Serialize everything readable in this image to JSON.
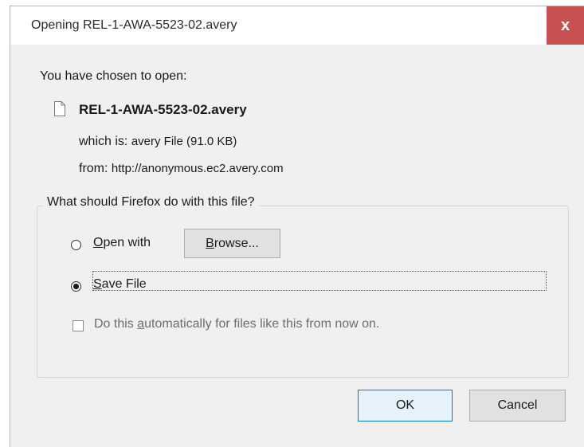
{
  "titlebar": {
    "title": "Opening REL-1-AWA-5523-02.avery",
    "close_label": "x"
  },
  "intro": {
    "heading": "You have chosen to open:",
    "file_name": "REL-1-AWA-5523-02.avery",
    "which_is_label": "which is:",
    "which_is_value": "avery File (91.0 KB)",
    "from_label": "from:",
    "from_value": "http://anonymous.ec2.avery.com"
  },
  "action_group": {
    "legend": "What should Firefox do with this file?",
    "open_with": {
      "prefix": "",
      "accesskey": "O",
      "rest": "pen with",
      "selected": false
    },
    "browse_button": {
      "accesskey": "B",
      "rest": "rowse..."
    },
    "save_file": {
      "accesskey": "S",
      "rest": "ave File",
      "selected": true
    },
    "auto_checkbox": {
      "before": "Do this ",
      "accesskey": "a",
      "rest": "utomatically for files like this from now on.",
      "checked": false,
      "enabled": false
    }
  },
  "buttons": {
    "ok_label": "OK",
    "cancel_label": "Cancel"
  },
  "colors": {
    "close_button": "#c75050",
    "dialog_bg": "#f0f0f0",
    "default_button_border": "#0078d7"
  }
}
